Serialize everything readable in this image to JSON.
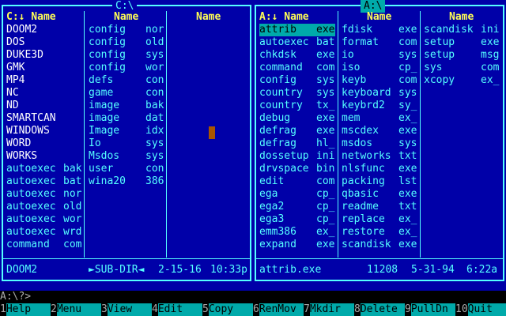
{
  "left_panel": {
    "drive": "C:\\",
    "columns": [
      "C:↓ Name",
      "Name",
      "Name"
    ],
    "col1": [
      {
        "name": "DOOM2",
        "ext": "",
        "type": "dir"
      },
      {
        "name": "DOS",
        "ext": "",
        "type": "dir"
      },
      {
        "name": "DUKE3D",
        "ext": "",
        "type": "dir"
      },
      {
        "name": "GMK",
        "ext": "",
        "type": "dir"
      },
      {
        "name": "MP4",
        "ext": "",
        "type": "dir"
      },
      {
        "name": "NC",
        "ext": "",
        "type": "dir"
      },
      {
        "name": "ND",
        "ext": "",
        "type": "dir"
      },
      {
        "name": "SMARTCAN",
        "ext": "",
        "type": "dir"
      },
      {
        "name": "WINDOWS",
        "ext": "",
        "type": "dir"
      },
      {
        "name": "WORD",
        "ext": "",
        "type": "dir"
      },
      {
        "name": "WORKS",
        "ext": "",
        "type": "dir"
      },
      {
        "name": "autoexec",
        "ext": "bak",
        "type": "file"
      },
      {
        "name": "autoexec",
        "ext": "bat",
        "type": "file"
      },
      {
        "name": "autoexec",
        "ext": "nor",
        "type": "file"
      },
      {
        "name": "autoexec",
        "ext": "old",
        "type": "file"
      },
      {
        "name": "autoexec",
        "ext": "wor",
        "type": "file"
      },
      {
        "name": "autoexec",
        "ext": "wrd",
        "type": "file"
      },
      {
        "name": "command",
        "ext": "com",
        "type": "file"
      }
    ],
    "col2": [
      {
        "name": "config",
        "ext": "nor"
      },
      {
        "name": "config",
        "ext": "old"
      },
      {
        "name": "config",
        "ext": "sys"
      },
      {
        "name": "config",
        "ext": "wor"
      },
      {
        "name": "defs",
        "ext": "con"
      },
      {
        "name": "game",
        "ext": "con"
      },
      {
        "name": "image",
        "ext": "bak"
      },
      {
        "name": "image",
        "ext": "dat"
      },
      {
        "name": "Image",
        "ext": "idx"
      },
      {
        "name": "Io",
        "ext": "sys"
      },
      {
        "name": "Msdos",
        "ext": "sys"
      },
      {
        "name": "user",
        "ext": "con"
      },
      {
        "name": "wina20",
        "ext": "386"
      }
    ],
    "status": {
      "name": "DOOM2",
      "type": "►SUB-DIR◄",
      "date": "2-15-16",
      "time": "10:33p"
    }
  },
  "right_panel": {
    "drive": "A:\\",
    "columns": [
      "A:↓ Name",
      "Name",
      "Name"
    ],
    "col1": [
      {
        "name": "attrib",
        "ext": "exe"
      },
      {
        "name": "autoexec",
        "ext": "bat"
      },
      {
        "name": "chkdsk",
        "ext": "exe"
      },
      {
        "name": "command",
        "ext": "com"
      },
      {
        "name": "config",
        "ext": "sys"
      },
      {
        "name": "country",
        "ext": "sys"
      },
      {
        "name": "country",
        "ext": "tx_"
      },
      {
        "name": "debug",
        "ext": "exe"
      },
      {
        "name": "defrag",
        "ext": "exe"
      },
      {
        "name": "defrag",
        "ext": "hl_"
      },
      {
        "name": "dossetup",
        "ext": "ini"
      },
      {
        "name": "drvspace",
        "ext": "bin"
      },
      {
        "name": "edit",
        "ext": "com"
      },
      {
        "name": "ega",
        "ext": "cp_"
      },
      {
        "name": "ega2",
        "ext": "cp_"
      },
      {
        "name": "ega3",
        "ext": "cp_"
      },
      {
        "name": "emm386",
        "ext": "ex_"
      },
      {
        "name": "expand",
        "ext": "exe"
      }
    ],
    "col2": [
      {
        "name": "fdisk",
        "ext": "exe"
      },
      {
        "name": "format",
        "ext": "com"
      },
      {
        "name": "io",
        "ext": "sys"
      },
      {
        "name": "iso",
        "ext": "cp_"
      },
      {
        "name": "keyb",
        "ext": "com"
      },
      {
        "name": "keyboard",
        "ext": "sys"
      },
      {
        "name": "keybrd2",
        "ext": "sy_"
      },
      {
        "name": "mem",
        "ext": "ex_"
      },
      {
        "name": "mscdex",
        "ext": "exe"
      },
      {
        "name": "msdos",
        "ext": "sys"
      },
      {
        "name": "networks",
        "ext": "txt"
      },
      {
        "name": "nlsfunc",
        "ext": "exe"
      },
      {
        "name": "packing",
        "ext": "lst"
      },
      {
        "name": "qbasic",
        "ext": "exe"
      },
      {
        "name": "readme",
        "ext": "txt"
      },
      {
        "name": "replace",
        "ext": "ex_"
      },
      {
        "name": "restore",
        "ext": "ex_"
      },
      {
        "name": "scandisk",
        "ext": "exe"
      }
    ],
    "col3": [
      {
        "name": "scandisk",
        "ext": "ini"
      },
      {
        "name": "setup",
        "ext": "exe"
      },
      {
        "name": "setup",
        "ext": "msg"
      },
      {
        "name": "sys",
        "ext": "com"
      },
      {
        "name": "xcopy",
        "ext": "ex_"
      }
    ],
    "status": {
      "name": "attrib.exe",
      "size": "11208",
      "date": "5-31-94",
      "time": "6:22a"
    }
  },
  "command_line": "A:\\?>",
  "function_keys": [
    {
      "num": "1",
      "label": "Help"
    },
    {
      "num": "2",
      "label": "Menu"
    },
    {
      "num": "3",
      "label": "View"
    },
    {
      "num": "4",
      "label": "Edit"
    },
    {
      "num": "5",
      "label": "Copy"
    },
    {
      "num": "6",
      "label": "RenMov"
    },
    {
      "num": "7",
      "label": "Mkdir"
    },
    {
      "num": "8",
      "label": "Delete"
    },
    {
      "num": "9",
      "label": "PullDn"
    },
    {
      "num": "10",
      "label": "Quit"
    }
  ],
  "colors": {
    "panel_bg": "#0000a8",
    "text": "#55ffff",
    "header": "#ffff55",
    "dir": "#ffffff",
    "selection": "#00aaaa",
    "cursor": "#aa5500"
  }
}
